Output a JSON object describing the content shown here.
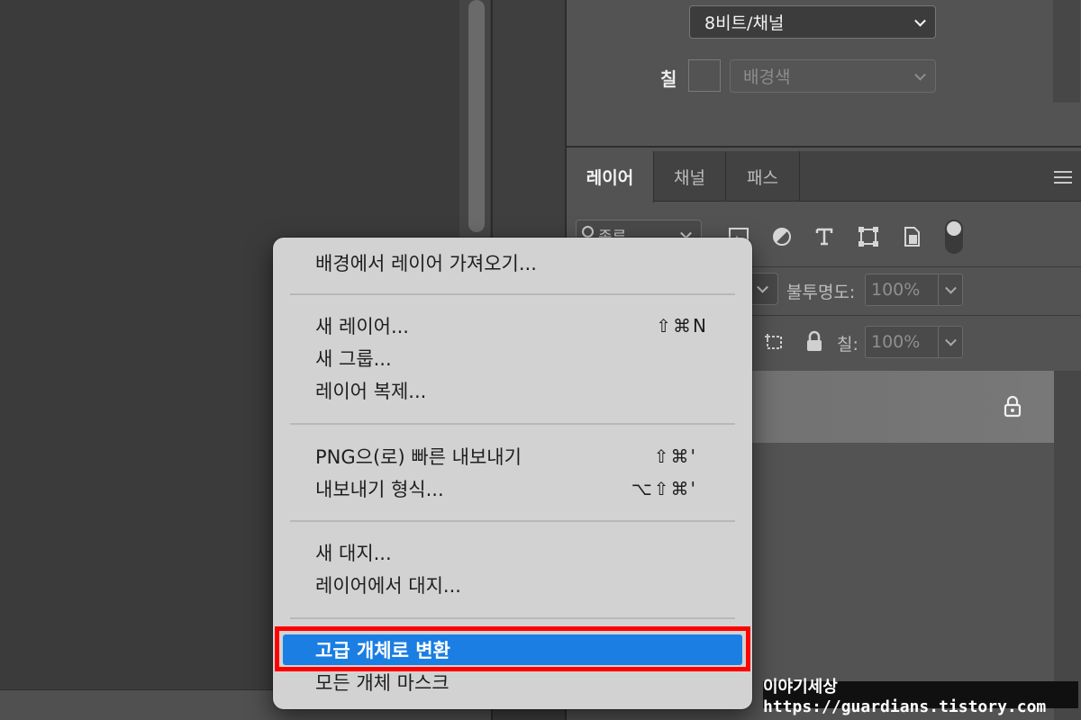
{
  "properties": {
    "bit_depth": "8비트/채널",
    "fill_label": "칠",
    "fill_color_select": "배경색"
  },
  "layers_panel": {
    "tabs": [
      {
        "label": "레이어",
        "active": true
      },
      {
        "label": "채널",
        "active": false
      },
      {
        "label": "패스",
        "active": false
      }
    ],
    "filter_kind": "종류",
    "opacity_label": "불투명도:",
    "opacity_value": "100%",
    "fill_label": "칠:",
    "fill_value": "100%"
  },
  "context_menu": {
    "items": [
      {
        "label": "배경에서 레이어 가져오기...",
        "shortcut": ""
      },
      {
        "label": "새 레이어...",
        "shortcut": "⇧⌘N"
      },
      {
        "label": "새 그룹...",
        "shortcut": ""
      },
      {
        "label": "레이어 복제...",
        "shortcut": ""
      },
      {
        "label": "PNG으(로) 빠른 내보내기",
        "shortcut": "⇧⌘'"
      },
      {
        "label": "내보내기 형식...",
        "shortcut": "⌥⇧⌘'"
      },
      {
        "label": "새 대지...",
        "shortcut": ""
      },
      {
        "label": "레이어에서 대지...",
        "shortcut": ""
      },
      {
        "label": "고급 개체로 변환",
        "shortcut": "",
        "highlighted": true
      },
      {
        "label": "모든 개체 마스크",
        "shortcut": ""
      }
    ],
    "highlight_color": "#1a7ee3",
    "callout_color": "#ff0000"
  },
  "watermark": "이야기세상 https://guardians.tistory.com"
}
